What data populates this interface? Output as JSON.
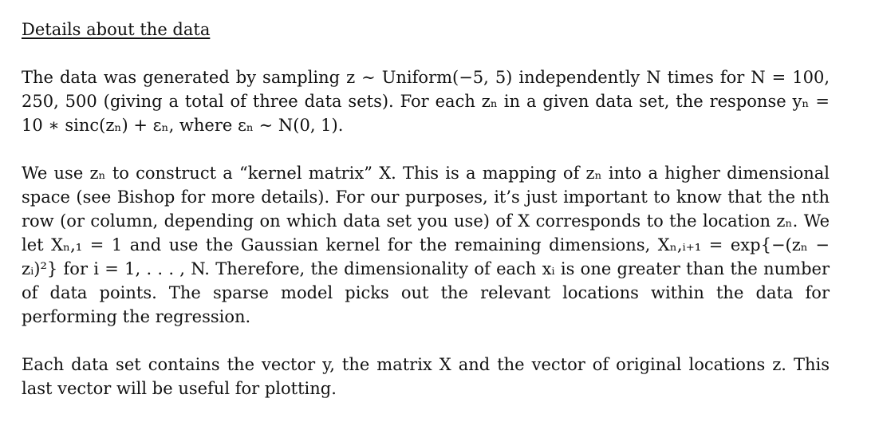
{
  "section": {
    "heading": "Details about the data",
    "paragraphs": [
      "The data was generated by sampling z ∼ Uniform(−5, 5) independently N times for N = 100, 250, 500 (giving a total of three data sets). For each zₙ in a given data set, the response yₙ = 10 ∗ sinc(zₙ) + εₙ, where εₙ ∼ N(0, 1).",
      "We use zₙ to construct a “kernel matrix” X. This is a mapping of zₙ into a higher dimensional space (see Bishop for more details). For our purposes, it’s just important to know that the nth row (or column, depending on which data set you use) of X corresponds to the location zₙ. We let Xₙ,₁ = 1 and use the Gaussian kernel for the remaining dimensions, Xₙ,ᵢ₊₁ = exp{−(zₙ − zᵢ)²} for i = 1, . . . , N. Therefore, the dimensionality of each xᵢ is one greater than the number of data points. The sparse model picks out the relevant locations within the data for performing the regression.",
      "Each data set contains the vector y, the matrix X and the vector of original locations z. This last vector will be useful for plotting."
    ]
  }
}
